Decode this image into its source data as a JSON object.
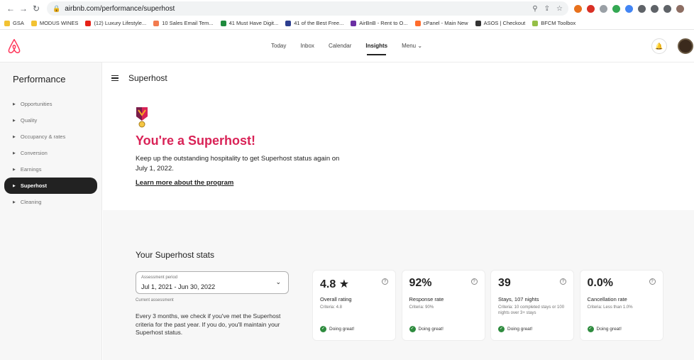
{
  "browser": {
    "url": "airbnb.com/performance/superhost",
    "bookmarks": [
      {
        "label": "GSA",
        "color": "#f2c232"
      },
      {
        "label": "MODUS WINES",
        "color": "#f2c232"
      },
      {
        "label": "(12) Luxury Lifestyle...",
        "color": "#e62117"
      },
      {
        "label": "10 Sales Email Tem...",
        "color": "#f27b4f"
      },
      {
        "label": "41 Must Have Digit...",
        "color": "#1f8a3d"
      },
      {
        "label": "41 of the Best Free...",
        "color": "#2c3e8f"
      },
      {
        "label": "AirBnB - Rent to O...",
        "color": "#6b2fa3"
      },
      {
        "label": "cPanel - Main New",
        "color": "#ff6c2c"
      },
      {
        "label": "ASOS | Checkout",
        "color": "#333333"
      },
      {
        "label": "BFCM Toolbox",
        "color": "#95bf47"
      }
    ]
  },
  "header": {
    "nav": [
      {
        "label": "Today",
        "active": false
      },
      {
        "label": "Inbox",
        "active": false
      },
      {
        "label": "Calendar",
        "active": false
      },
      {
        "label": "Insights",
        "active": true
      },
      {
        "label": "Menu ⌄",
        "active": false
      }
    ],
    "brand_color": "#ff385c"
  },
  "sidebar": {
    "title": "Performance",
    "items": [
      {
        "label": "Opportunities",
        "active": false
      },
      {
        "label": "Quality",
        "active": false
      },
      {
        "label": "Occupancy & rates",
        "active": false
      },
      {
        "label": "Conversion",
        "active": false
      },
      {
        "label": "Earnings",
        "active": false
      },
      {
        "label": "Superhost",
        "active": true
      },
      {
        "label": "Cleaning",
        "active": false
      }
    ]
  },
  "main": {
    "title": "Superhost",
    "hero": {
      "heading": "You're a Superhost!",
      "text": "Keep up the outstanding hospitality to get Superhost status again on July 1, 2022.",
      "link": "Learn more about the program"
    },
    "stats": {
      "heading": "Your Superhost stats",
      "period_label": "Assessment period",
      "period_value": "Jul 1, 2021 - Jun 30, 2022",
      "current": "Current assessment",
      "explain": "Every 3 months, we check if you've met the Superhost criteria for the past year. If you do, you'll maintain your Superhost status.",
      "cards": [
        {
          "value": "4.8 ★",
          "name": "Overall rating",
          "criteria": "Criteria: 4.8",
          "status": "Doing great!"
        },
        {
          "value": "92%",
          "name": "Response rate",
          "criteria": "Criteria: 90%",
          "status": "Doing great!"
        },
        {
          "value": "39",
          "name": "Stays, 107 nights",
          "criteria": "Criteria: 10 completed stays or 100 nights over 3+ stays",
          "status": "Doing great!"
        },
        {
          "value": "0.0%",
          "name": "Cancellation rate",
          "criteria": "Criteria: Less than 1.0%",
          "status": "Doing great!"
        }
      ]
    }
  }
}
